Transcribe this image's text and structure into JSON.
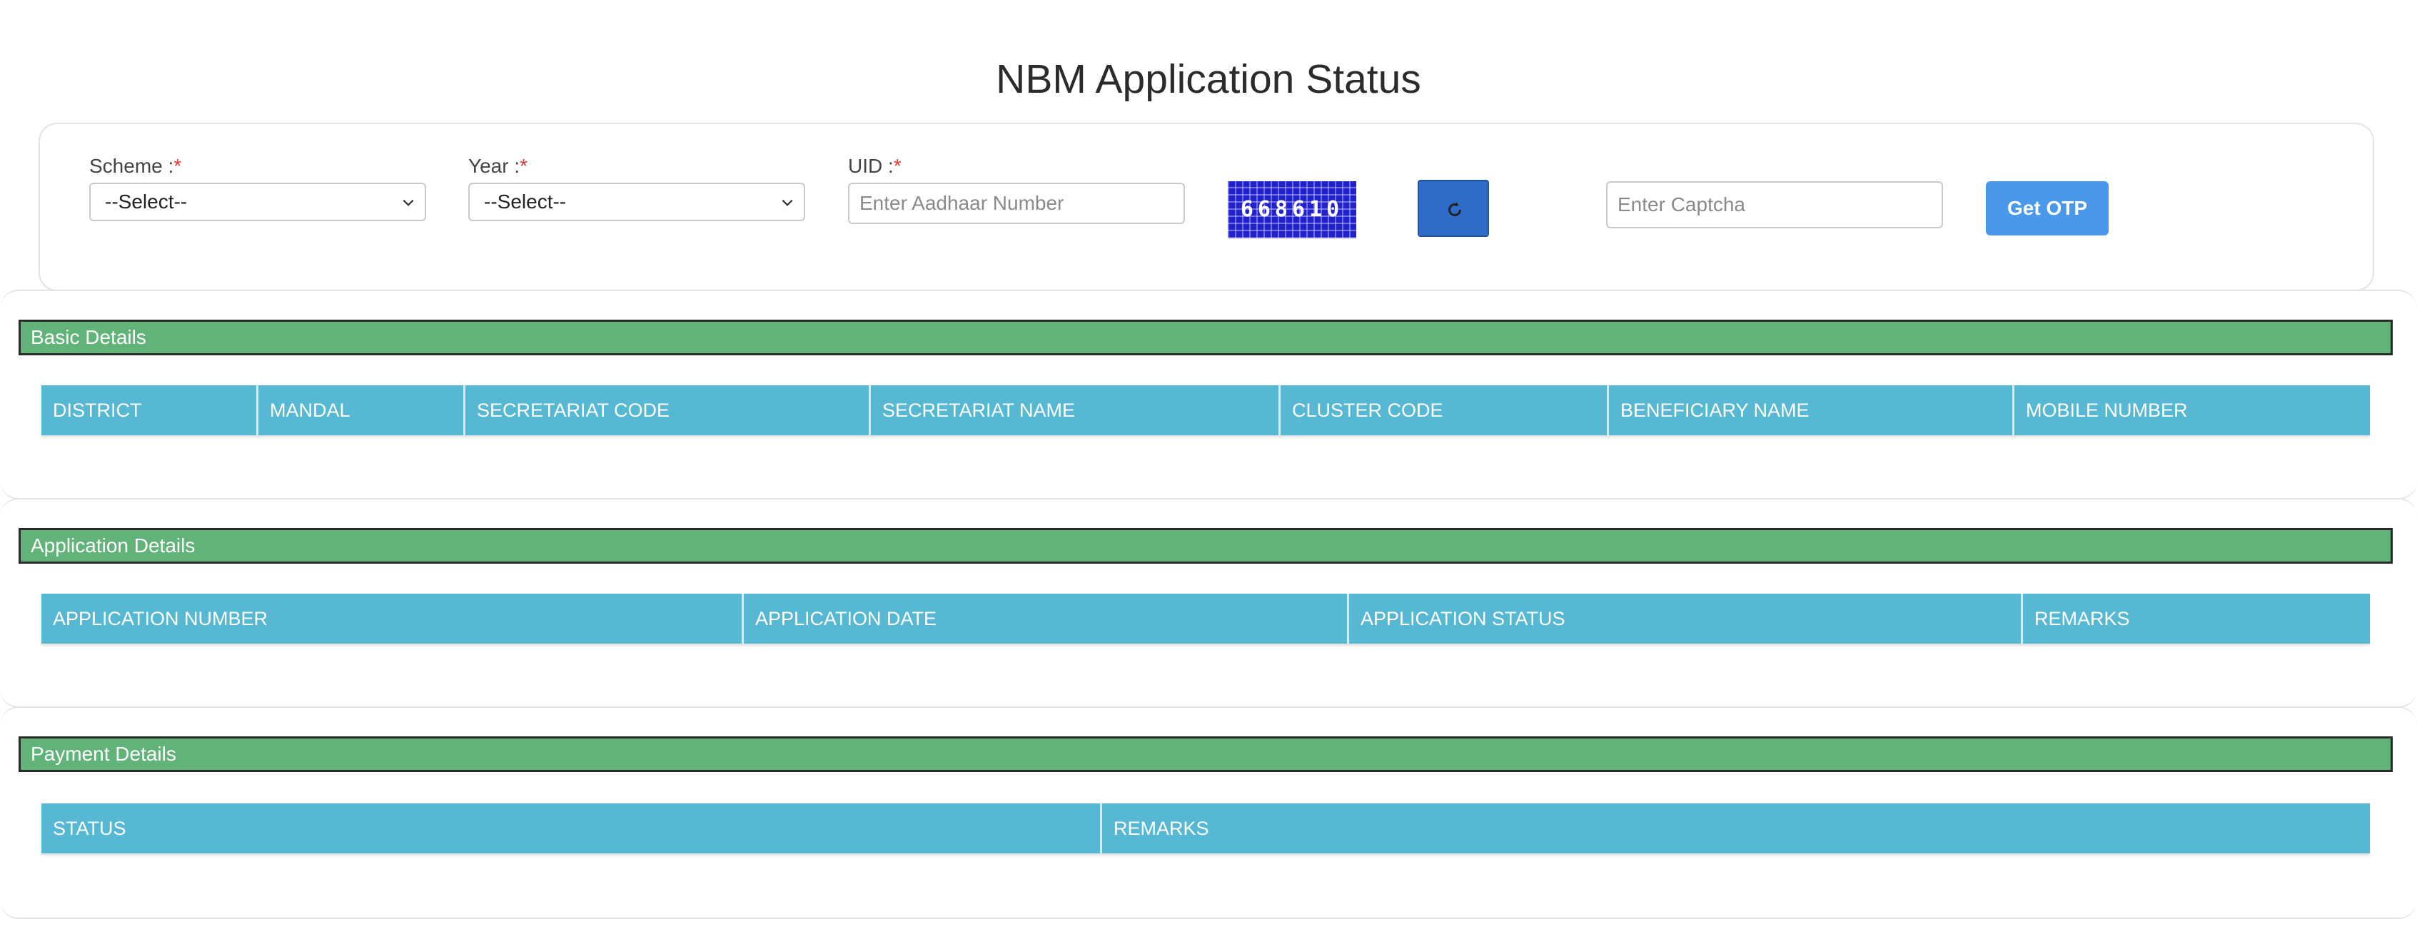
{
  "page": {
    "title": "NBM Application Status"
  },
  "form": {
    "scheme": {
      "label": "Scheme :",
      "required_mark": "*",
      "value": "--Select--"
    },
    "year": {
      "label": "Year :",
      "required_mark": "*",
      "value": "--Select--"
    },
    "uid": {
      "label": "UID :",
      "required_mark": "*",
      "placeholder": "Enter Aadhaar Number"
    },
    "captcha": {
      "code": "668610",
      "placeholder": "Enter Captcha"
    },
    "refresh_icon": "refresh-icon",
    "otp_button": "Get OTP"
  },
  "sections": {
    "basic": {
      "title": "Basic Details",
      "columns": [
        "DISTRICT",
        "MANDAL",
        "SECRETARIAT CODE",
        "SECRETARIAT NAME",
        "CLUSTER CODE",
        "BENEFICIARY NAME",
        "MOBILE NUMBER"
      ]
    },
    "application": {
      "title": "Application Details",
      "columns": [
        "APPLICATION NUMBER",
        "APPLICATION DATE",
        "APPLICATION STATUS",
        "REMARKS"
      ]
    },
    "payment": {
      "title": "Payment Details",
      "columns": [
        "STATUS",
        "REMARKS"
      ]
    }
  },
  "colors": {
    "section_header": "#62b37a",
    "table_header": "#56b8d3",
    "otp_button": "#4a98ea",
    "refresh_button": "#2f6cc8",
    "captcha_bg": "#2222cc",
    "required": "#e23a3a"
  }
}
